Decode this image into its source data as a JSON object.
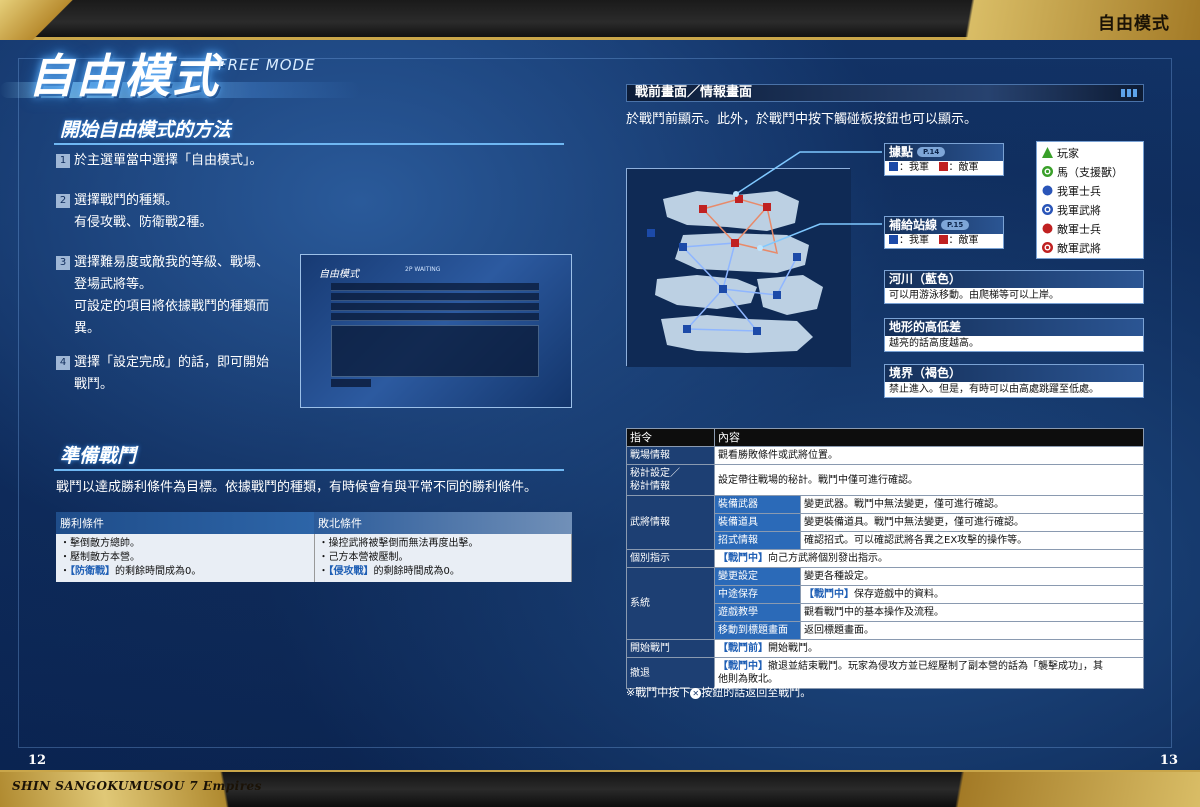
{
  "header": {
    "top_right_title": "自由模式",
    "footer_title": "SHIN SANGOKUMUSOU 7 Empires",
    "page_left": "12",
    "page_right": "13"
  },
  "left": {
    "main_title": "自由模式",
    "main_subtitle": "FREE MODE",
    "section1_title": "開始自由模式的方法",
    "steps": [
      {
        "num": "1",
        "lines": [
          "於主選單當中選擇「自由模式」。"
        ]
      },
      {
        "num": "2",
        "lines": [
          "選擇戰鬥的種類。",
          "有侵攻戰、防衛戰2種。"
        ]
      },
      {
        "num": "3",
        "lines": [
          "選擇難易度或敵我的等級、戰場、",
          "登場武將等。",
          "可設定的項目將依據戰鬥的種類而",
          "異。"
        ]
      },
      {
        "num": "4",
        "lines": [
          "選擇「設定完成」的話，即可開始",
          "戰鬥。"
        ]
      }
    ],
    "screenshot": {
      "title": "自由模式",
      "sub": "2P WAITING"
    },
    "section2_title": "準備戰鬥",
    "section2_desc": "戰鬥以達成勝利條件為目標。依據戰鬥的種類，有時候會有與平常不同的勝利條件。",
    "victory_table": {
      "col1_header": "勝利條件",
      "col2_header": "敗北條件",
      "col1_lines": [
        {
          "pre": "・擊倒敵方總帥。",
          "hl": "",
          "post": ""
        },
        {
          "pre": "・壓制敵方本營。",
          "hl": "",
          "post": ""
        },
        {
          "pre": "・",
          "hl": "【防衛戰】",
          "post": "的剩餘時間成為0。"
        }
      ],
      "col2_lines": [
        {
          "pre": "・操控武將被擊倒而無法再度出擊。",
          "hl": "",
          "post": ""
        },
        {
          "pre": "・己方本營被壓制。",
          "hl": "",
          "post": ""
        },
        {
          "pre": "・",
          "hl": "【侵攻戰】",
          "post": "的剩餘時間成為0。"
        }
      ]
    }
  },
  "right": {
    "panel_title": "戰前畫面／情報畫面",
    "panel_desc": "於戰鬥前顯示。此外，於戰鬥中按下觸碰板按鈕也可以顯示。",
    "callout_base": {
      "title": "據點",
      "tag": "P.14",
      "line": [
        "：我軍",
        "：敵軍"
      ]
    },
    "callout_supply": {
      "title": "補給站線",
      "tag": "P.15",
      "line": [
        "：我軍",
        "：敵軍"
      ]
    },
    "legend": [
      {
        "icon": "player-triangle-icon",
        "label": "玩家",
        "color": "#3aa02a"
      },
      {
        "icon": "horse-icon",
        "label": "馬（支援獸）",
        "color": "#3aa02a"
      },
      {
        "icon": "ally-soldier-icon",
        "label": "我軍士兵",
        "color": "#2a55b8"
      },
      {
        "icon": "ally-officer-icon",
        "label": "我軍武將",
        "color": "#2a55b8"
      },
      {
        "icon": "enemy-soldier-icon",
        "label": "敵軍士兵",
        "color": "#c02121"
      },
      {
        "icon": "enemy-officer-icon",
        "label": "敵軍武將",
        "color": "#c02121"
      }
    ],
    "info": [
      {
        "title": "河川（藍色）",
        "text": "可以用游泳移動。由爬梯等可以上岸。"
      },
      {
        "title": "地形的高低差",
        "text": "越亮的話高度越高。"
      },
      {
        "title": "境界（褐色）",
        "text": "禁止進入。但是，有時可以由高處跳躍至低處。"
      }
    ],
    "cmd_table": {
      "h1": "指令",
      "h2": "內容",
      "r_field": [
        "戰場情報",
        "觀看勝敗條件或武將位置。"
      ],
      "r_secret_k1": "秘計設定／",
      "r_secret_k2": "秘計情報",
      "r_secret_v": "設定帶往戰場的秘計。戰鬥中僅可進行確認。",
      "r_officer_k": "武將情報",
      "r_officer_sub": [
        [
          "裝備武器",
          "變更武器。戰鬥中無法變更，僅可進行確認。"
        ],
        [
          "裝備道具",
          "變更裝備道具。戰鬥中無法變更，僅可進行確認。"
        ],
        [
          "招式情報",
          "確認招式。可以確認武將各異之EX攻擊的操作等。"
        ]
      ],
      "r_order_k": "個別指示",
      "r_order_hl": "【戰鬥中】",
      "r_order_v": "向己方武將個別發出指示。",
      "r_system_k": "系統",
      "r_system_sub": [
        {
          "k": "變更設定",
          "hl": "",
          "v": "變更各種設定。"
        },
        {
          "k": "中途保存",
          "hl": "【戰鬥中】",
          "v": "保存遊戲中的資料。"
        },
        {
          "k": "遊戲教學",
          "hl": "",
          "v": "觀看戰鬥中的基本操作及流程。"
        },
        {
          "k": "移動到標題畫面",
          "hl": "",
          "v": "返回標題畫面。"
        }
      ],
      "r_start_k": "開始戰鬥",
      "r_start_hl": "【戰鬥前】",
      "r_start_v": "開始戰鬥。",
      "r_retreat_k": "撤退",
      "r_retreat_hl": "【戰鬥中】",
      "r_retreat_v1": "撤退並結束戰鬥。玩家為侵攻方並已經壓制了副本營的話為「襲擊成功」，其",
      "r_retreat_v2": "他則為敗北。"
    },
    "note_pre": "※戰鬥中按下",
    "note_icon": "✕",
    "note_post": "按鈕的話返回至戰鬥。"
  }
}
